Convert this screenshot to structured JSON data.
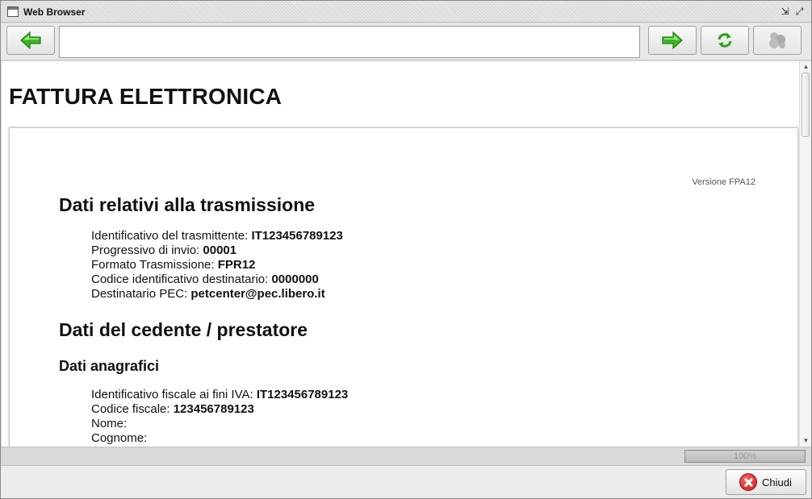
{
  "window": {
    "title": "Web Browser",
    "restore_glyph": "⇲",
    "maximize_glyph": "⤢"
  },
  "toolbar": {
    "back_icon": "green-left-arrow-icon",
    "url_value": "",
    "forward_icon": "green-right-arrow-icon",
    "refresh_icon": "green-refresh-icon",
    "extra_icon": "gray-puzzle-icon",
    "accent_green": "#3cb521"
  },
  "page": {
    "title": "FATTURA ELETTRONICA",
    "version": "Versione FPA12",
    "section1": {
      "title": "Dati relativi alla trasmissione",
      "fields": [
        {
          "label": "Identificativo del trasmittente: ",
          "value": "IT123456789123"
        },
        {
          "label": "Progressivo di invio: ",
          "value": "00001"
        },
        {
          "label": "Formato Trasmissione: ",
          "value": "FPR12"
        },
        {
          "label": "Codice identificativo destinatario: ",
          "value": "0000000"
        },
        {
          "label": "Destinatario PEC: ",
          "value": "petcenter@pec.libero.it"
        }
      ]
    },
    "section2": {
      "title": "Dati del cedente / prestatore",
      "subtitle": "Dati anagrafici",
      "fields": [
        {
          "label": "Identificativo fiscale ai fini IVA: ",
          "value": "IT123456789123"
        },
        {
          "label": "Codice fiscale: ",
          "value": "123456789123"
        },
        {
          "label": "Nome:",
          "value": ""
        },
        {
          "label": "Cognome:",
          "value": ""
        }
      ]
    }
  },
  "status": {
    "progress_label": "100%",
    "progress_fraction": 1.0
  },
  "bottom": {
    "close_label": "Chiudi"
  }
}
